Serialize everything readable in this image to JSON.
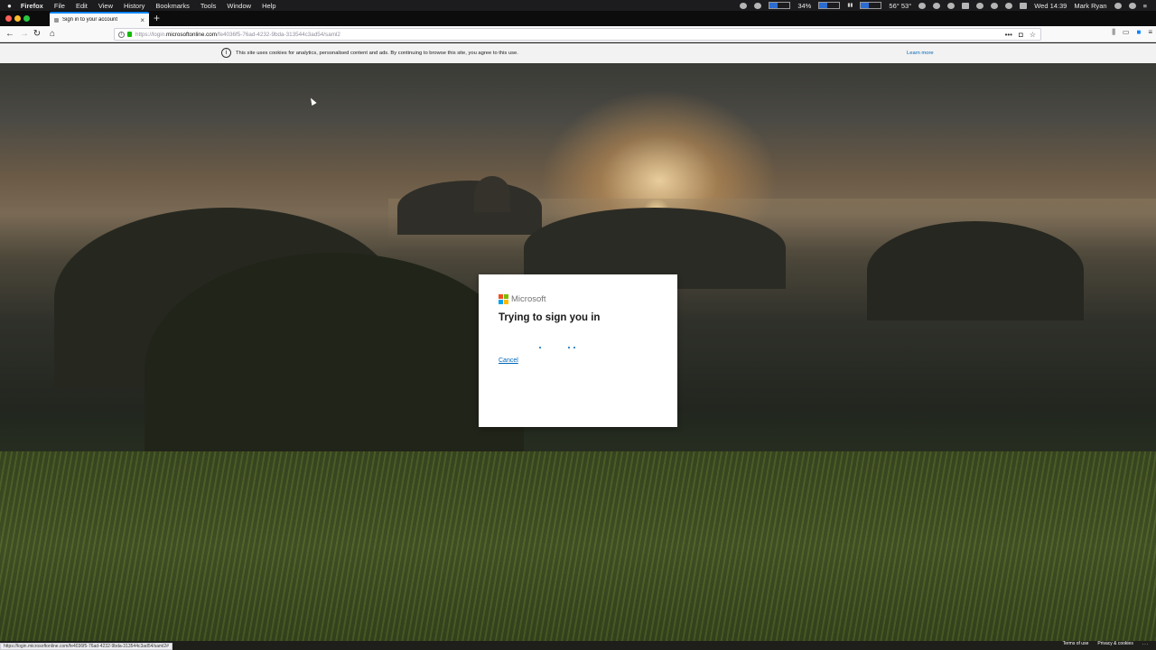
{
  "menubar": {
    "items": [
      "Firefox",
      "File",
      "Edit",
      "View",
      "History",
      "Bookmarks",
      "Tools",
      "Window",
      "Help"
    ],
    "battery": "34%",
    "temps": "56° 53°",
    "clock": "Wed 14:39",
    "user": "Mark Ryan"
  },
  "tab": {
    "title": "Sign in to your account",
    "close": "×",
    "new_tab": "+"
  },
  "urlbar": {
    "scheme": "https://login.",
    "domain": "microsoftonline.com",
    "path": "/fe4036f5-76ad-4232-9bda-313544c3ad54/saml2",
    "more": "•••"
  },
  "cookie_banner": {
    "text": "This site uses cookies for analytics, personalised content and ads. By continuing to browse this site, you agree to this use.",
    "learn_more": "Learn more",
    "info_icon": "i"
  },
  "card": {
    "brand": "Microsoft",
    "title": "Trying to sign you in",
    "cancel": "Cancel"
  },
  "status_url": "https://login.microsoftonline.com/fe4036f5-76ad-4232-9bda-313544c3ad54/saml2#",
  "footer": {
    "terms": "Terms of use",
    "privacy": "Privacy & cookies",
    "more": "..."
  },
  "colors": {
    "ms_red": "#f25022",
    "ms_green": "#7fba00",
    "ms_blue": "#00a4ef",
    "ms_yellow": "#ffb900",
    "link": "#0067b8"
  }
}
